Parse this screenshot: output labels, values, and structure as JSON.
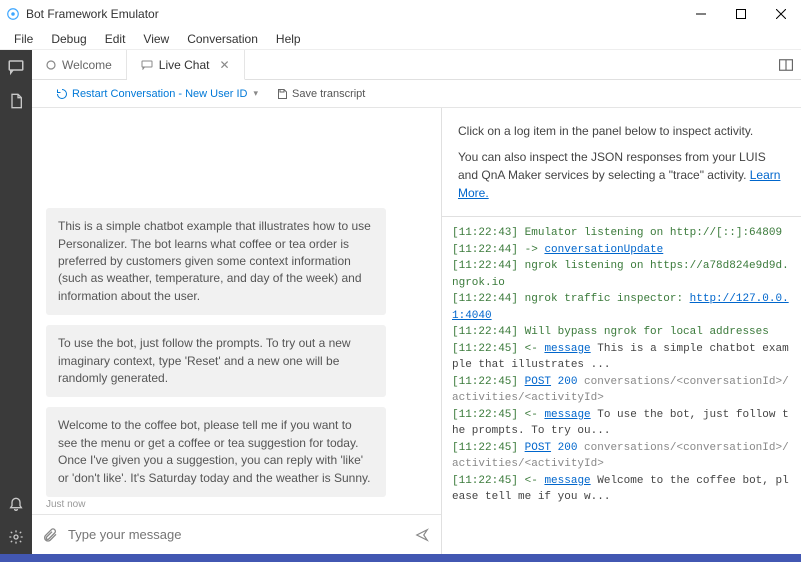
{
  "window": {
    "title": "Bot Framework Emulator"
  },
  "menu": {
    "items": [
      "File",
      "Debug",
      "Edit",
      "View",
      "Conversation",
      "Help"
    ]
  },
  "tabs": {
    "items": [
      {
        "label": "Welcome",
        "active": false
      },
      {
        "label": "Live Chat",
        "active": true
      }
    ]
  },
  "toolbar": {
    "restart_label": "Restart Conversation - New User ID",
    "save_label": "Save transcript"
  },
  "chat": {
    "messages": [
      "This is a simple chatbot example that illustrates how to use Personalizer. The bot learns what coffee or tea order is preferred by customers given some context information (such as weather, temperature, and day of the week) and information about the user.",
      "To use the bot, just follow the prompts. To try out a new imaginary context, type 'Reset' and a new one will be randomly generated.",
      "Welcome to the coffee bot, please tell me if you want to see the menu or get a coffee or tea suggestion for today. Once I've given you a suggestion, you can reply with 'like' or 'don't like'. It's Saturday today and the weather is Sunny."
    ],
    "timestamp": "Just now",
    "input_placeholder": "Type your message"
  },
  "inspector": {
    "line1": "Click on a log item in the panel below to inspect activity.",
    "line2_pre": "You can also inspect the JSON responses from your LUIS and QnA Maker services by selecting a \"trace\" activity. ",
    "learn_more": "Learn More."
  },
  "log": {
    "lines": [
      {
        "ts": "[11:22:43]",
        "body": [
          {
            "t": "text",
            "v": "Emulator listening on http://[::]:64809"
          }
        ]
      },
      {
        "ts": "[11:22:44]",
        "body": [
          {
            "t": "arrow",
            "v": "-> "
          },
          {
            "t": "link",
            "v": "conversationUpdate"
          }
        ]
      },
      {
        "ts": "[11:22:44]",
        "body": [
          {
            "t": "text",
            "v": "ngrok listening on https://a78d824e9d9d.ngrok.io"
          }
        ]
      },
      {
        "ts": "[11:22:44]",
        "body": [
          {
            "t": "text",
            "v": "ngrok traffic inspector: "
          },
          {
            "t": "link",
            "v": "http://127.0.0.1:4040"
          }
        ]
      },
      {
        "ts": "[11:22:44]",
        "body": [
          {
            "t": "text",
            "v": "Will bypass ngrok for local addresses"
          }
        ]
      },
      {
        "ts": "[11:22:45]",
        "body": [
          {
            "t": "arrow",
            "v": "<- "
          },
          {
            "t": "link",
            "v": "message"
          },
          {
            "t": "plain",
            "v": " This is a simple chatbot example that illustrates ..."
          }
        ]
      },
      {
        "ts": "[11:22:45]",
        "body": [
          {
            "t": "link",
            "v": "POST"
          },
          {
            "t": "plain",
            "v": " "
          },
          {
            "t": "status",
            "v": "200"
          },
          {
            "t": "gray",
            "v": " conversations/<conversationId>/activities/<activityId>"
          }
        ]
      },
      {
        "ts": "[11:22:45]",
        "body": [
          {
            "t": "arrow",
            "v": "<- "
          },
          {
            "t": "link",
            "v": "message"
          },
          {
            "t": "plain",
            "v": " To use the bot, just follow the prompts. To try ou..."
          }
        ]
      },
      {
        "ts": "[11:22:45]",
        "body": [
          {
            "t": "link",
            "v": "POST"
          },
          {
            "t": "plain",
            "v": " "
          },
          {
            "t": "status",
            "v": "200"
          },
          {
            "t": "gray",
            "v": " conversations/<conversationId>/activities/<activityId>"
          }
        ]
      },
      {
        "ts": "[11:22:45]",
        "body": [
          {
            "t": "arrow",
            "v": "<- "
          },
          {
            "t": "link",
            "v": "message"
          },
          {
            "t": "plain",
            "v": " Welcome to the coffee bot, please tell me if you w..."
          }
        ]
      }
    ]
  }
}
